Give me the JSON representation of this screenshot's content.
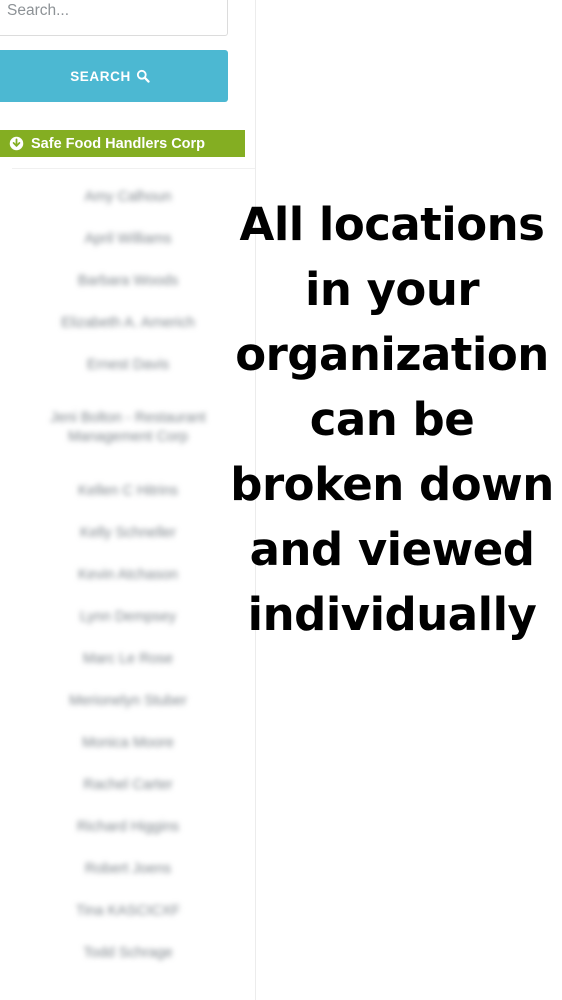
{
  "search": {
    "placeholder": "Search...",
    "value": "",
    "button_label": "SEARCH",
    "button_icon": "magnifier-icon",
    "button_color": "#4cb8d2"
  },
  "corp_header": {
    "label": "Safe Food Handlers Corp",
    "icon": "circle-arrow-down-icon",
    "background_color": "#84ae22",
    "text_color": "#ffffff"
  },
  "location_list": {
    "items": [
      {
        "label": "Amy Calhoun",
        "two_line": false
      },
      {
        "label": "April Williams",
        "two_line": false
      },
      {
        "label": "Barbara Woods",
        "two_line": false
      },
      {
        "label": "Elizabeth A. Arnerich",
        "two_line": false
      },
      {
        "label": "Ernest Davis",
        "two_line": false
      },
      {
        "label": "Jeni Bolton - Restaurant Management Corp",
        "two_line": true
      },
      {
        "label": "Kellen C Hitrins",
        "two_line": false
      },
      {
        "label": "Kelly Schneller",
        "two_line": false
      },
      {
        "label": "Kevin Atchason",
        "two_line": false
      },
      {
        "label": "Lynn Dempsey",
        "two_line": false
      },
      {
        "label": "Marc Le Rose",
        "two_line": false
      },
      {
        "label": "Merionelyn Stuber",
        "two_line": false
      },
      {
        "label": "Monica Moore",
        "two_line": false
      },
      {
        "label": "Rachel Carter",
        "two_line": false
      },
      {
        "label": "Richard Higgins",
        "two_line": false
      },
      {
        "label": "Robert Joens",
        "two_line": false
      },
      {
        "label": "Tina KASCICXF",
        "two_line": false
      },
      {
        "label": "Todd Schrage",
        "two_line": false
      }
    ]
  },
  "overlay": {
    "caption": "All locations in your organization can be broken down and viewed individually",
    "text_color": "#000000"
  }
}
